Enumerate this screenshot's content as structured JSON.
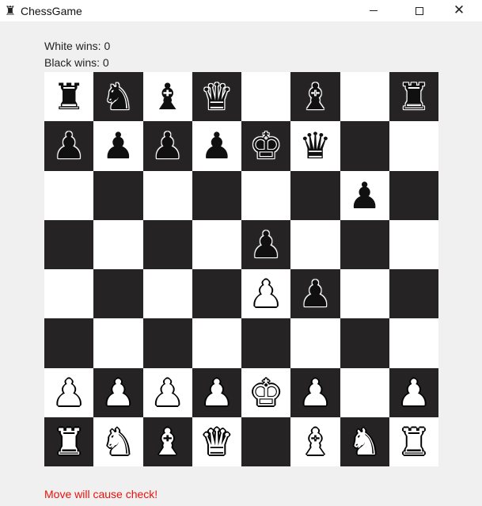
{
  "window": {
    "title": "ChessGame",
    "icon": "rook-icon"
  },
  "stats": {
    "white_wins": "White wins: 0",
    "black_wins": "Black wins: 0"
  },
  "status": {
    "message": "Move will cause check!",
    "color": "#e8120c"
  },
  "board": {
    "light_color": "#ffffff",
    "dark_color": "#252323",
    "first_square": "light",
    "ranks": [
      [
        {
          "type": "rook",
          "color": "black"
        },
        {
          "type": "knight",
          "color": "black"
        },
        {
          "type": "bishop",
          "color": "black"
        },
        {
          "type": "queen",
          "color": "black"
        },
        null,
        {
          "type": "bishop",
          "color": "black"
        },
        null,
        {
          "type": "rook",
          "color": "black"
        }
      ],
      [
        {
          "type": "pawn",
          "color": "black"
        },
        {
          "type": "pawn",
          "color": "black"
        },
        {
          "type": "pawn",
          "color": "black"
        },
        {
          "type": "pawn",
          "color": "black"
        },
        {
          "type": "king",
          "color": "black"
        },
        {
          "type": "queen",
          "color": "black"
        },
        null,
        null
      ],
      [
        null,
        null,
        null,
        null,
        null,
        null,
        {
          "type": "pawn",
          "color": "black"
        },
        null
      ],
      [
        null,
        null,
        null,
        null,
        {
          "type": "pawn",
          "color": "black"
        },
        null,
        null,
        null
      ],
      [
        null,
        null,
        null,
        null,
        {
          "type": "pawn",
          "color": "white"
        },
        {
          "type": "pawn",
          "color": "black"
        },
        null,
        null
      ],
      [
        null,
        null,
        null,
        null,
        null,
        null,
        null,
        null
      ],
      [
        {
          "type": "pawn",
          "color": "white"
        },
        {
          "type": "pawn",
          "color": "white"
        },
        {
          "type": "pawn",
          "color": "white"
        },
        {
          "type": "pawn",
          "color": "white"
        },
        {
          "type": "king",
          "color": "white"
        },
        {
          "type": "pawn",
          "color": "white"
        },
        null,
        {
          "type": "pawn",
          "color": "white"
        }
      ],
      [
        {
          "type": "rook",
          "color": "white"
        },
        {
          "type": "knight",
          "color": "white"
        },
        {
          "type": "bishop",
          "color": "white"
        },
        {
          "type": "queen",
          "color": "white"
        },
        null,
        {
          "type": "bishop",
          "color": "white"
        },
        {
          "type": "knight",
          "color": "white"
        },
        {
          "type": "rook",
          "color": "white"
        }
      ]
    ]
  }
}
